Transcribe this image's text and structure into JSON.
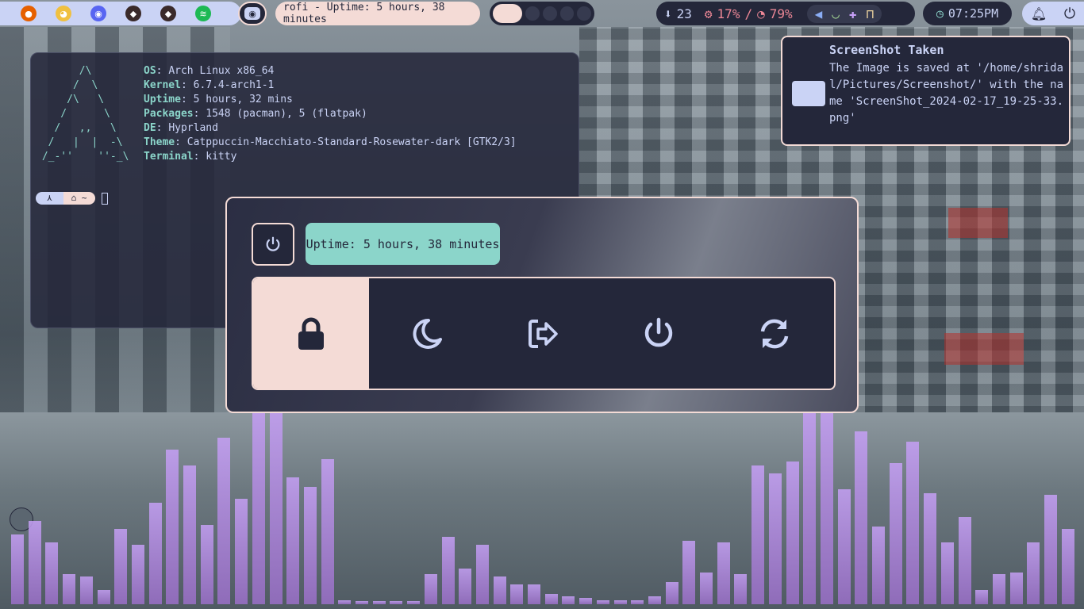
{
  "topbar": {
    "apps": [
      {
        "name": "firefox",
        "color": "#e66000",
        "glyph": "●"
      },
      {
        "name": "app-cat",
        "color": "#f0c040",
        "glyph": "◕"
      },
      {
        "name": "discord",
        "color": "#5865f2",
        "glyph": "◉"
      },
      {
        "name": "app-mascot-1",
        "color": "#3a2a2a",
        "glyph": "◆"
      },
      {
        "name": "app-mascot-2",
        "color": "#3a2a2a",
        "glyph": "◆"
      },
      {
        "name": "spotify",
        "color": "#1db954",
        "glyph": "≋"
      }
    ],
    "window_title": "rofi - Uptime: 5 hours, 38 minutes",
    "workspaces": 5,
    "active_workspace": 1,
    "updates": "23",
    "cpu": "17%",
    "separator": "/",
    "memory": "79%",
    "clock": "07:25PM",
    "colors": {
      "cpu": "#ed8796",
      "mem": "#ed8796",
      "accent": "#f4dbd6",
      "teal": "#8bd5ca"
    }
  },
  "terminal": {
    "ascii": "       /\\\n      /  \\\n     /\\   \\\n    /      \\\n   /   ,,   \\\n  /   |  |  -\\\n /_-''    ''-_\\",
    "info": [
      {
        "key": "OS",
        "value": "Arch Linux x86_64"
      },
      {
        "key": "Kernel",
        "value": "6.7.4-arch1-1"
      },
      {
        "key": "Uptime",
        "value": "5 hours, 32 mins"
      },
      {
        "key": "Packages",
        "value": "1548 (pacman), 5 (flatpak)"
      },
      {
        "key": "DE",
        "value": "Hyprland"
      },
      {
        "key": "Theme",
        "value": "Catppuccin-Macchiato-Standard-Rosewater-dark [GTK2/3]"
      },
      {
        "key": "Terminal",
        "value": "kitty"
      }
    ],
    "prompt_segment_a": "⋏",
    "prompt_segment_b": "⌂ ~"
  },
  "notification": {
    "title": "ScreenShot Taken",
    "body": "The Image is saved at '/home/shridal/Pictures/Screenshot/' with the name 'ScreenShot_2024-02-17_19-25-33.png'"
  },
  "power_menu": {
    "uptime": "Uptime: 5 hours, 38 minutes",
    "options": [
      "lock",
      "suspend",
      "logout",
      "shutdown",
      "reboot"
    ],
    "selected": 0
  },
  "visualizer": {
    "levels": [
      0.35,
      0.42,
      0.31,
      0.15,
      0.14,
      0.07,
      0.38,
      0.3,
      0.51,
      0.78,
      0.7,
      0.4,
      0.84,
      0.53,
      1,
      1,
      0.64,
      0.59,
      0.73,
      0.02,
      0.01,
      0.01,
      0.01,
      0.01,
      0.15,
      0.34,
      0.18,
      0.3,
      0.14,
      0.1,
      0.1,
      0.05,
      0.04,
      0.03,
      0.02,
      0.02,
      0.02,
      0.04,
      0.11,
      0.32,
      0.16,
      0.31,
      0.15,
      0.7,
      0.66,
      0.72,
      1,
      1,
      0.58,
      0.87,
      0.39,
      0.71,
      0.82,
      0.56,
      0.31,
      0.44,
      0.07,
      0.15,
      0.16,
      0.31,
      0.55,
      0.38
    ]
  }
}
